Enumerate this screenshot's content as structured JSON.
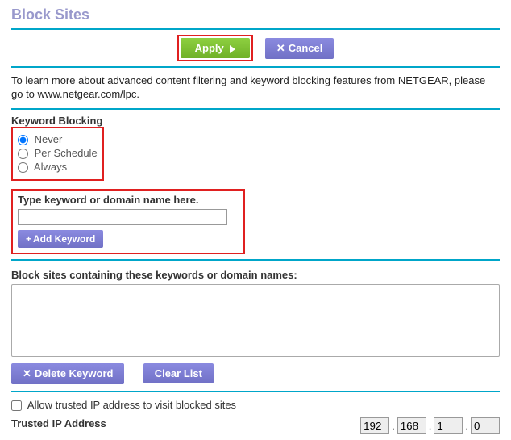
{
  "page": {
    "title": "Block Sites",
    "info_text_1": "To learn more about advanced content filtering and keyword blocking features from NETGEAR, please go to",
    "info_text_2": "www.netgear.com/lpc."
  },
  "buttons": {
    "apply": "Apply",
    "cancel": "Cancel",
    "add_keyword": "Add Keyword",
    "delete_keyword": "Delete Keyword",
    "clear_list": "Clear List"
  },
  "keyword_blocking": {
    "label": "Keyword Blocking",
    "options": {
      "never": "Never",
      "schedule": "Per Schedule",
      "always": "Always"
    },
    "selected": "never"
  },
  "keyword_input": {
    "label": "Type keyword or domain name here.",
    "value": ""
  },
  "block_list": {
    "label": "Block sites containing these keywords or domain names:"
  },
  "trusted": {
    "checkbox_label": "Allow trusted IP address to visit blocked sites",
    "ip_label": "Trusted IP Address",
    "octets": {
      "a": "192",
      "b": "168",
      "c": "1",
      "d": "0"
    }
  }
}
